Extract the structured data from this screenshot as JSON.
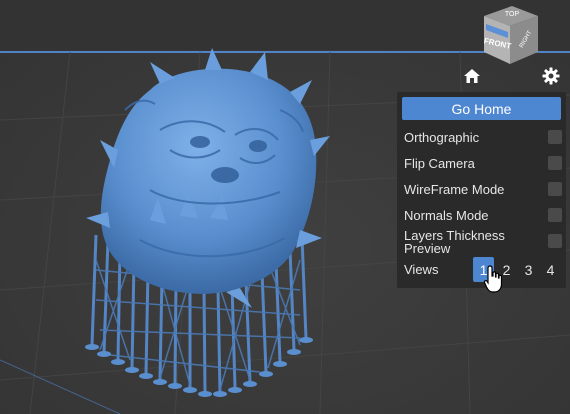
{
  "navcube": {
    "top": "TOP",
    "front": "FRONT",
    "right": "RIGHT"
  },
  "toolbar": {
    "home_icon": "home-icon",
    "settings_icon": "gear-icon"
  },
  "panel": {
    "go_home": "Go Home",
    "options": [
      {
        "label": "Orthographic",
        "checked": false
      },
      {
        "label": "Flip Camera",
        "checked": false
      },
      {
        "label": "WireFrame Mode",
        "checked": false
      },
      {
        "label": "Normals Mode",
        "checked": false
      },
      {
        "label": "Layers Thickness Preview",
        "line1": "Layers Thickness",
        "line2": "Preview",
        "checked": false
      }
    ],
    "views_label": "Views",
    "views": [
      "1",
      "2",
      "3",
      "4"
    ],
    "active_view": "1"
  },
  "colors": {
    "accent": "#4d86d1",
    "model": "#5a8fcf",
    "background": "#3a3a3a",
    "panel": "#2a2a2a"
  }
}
